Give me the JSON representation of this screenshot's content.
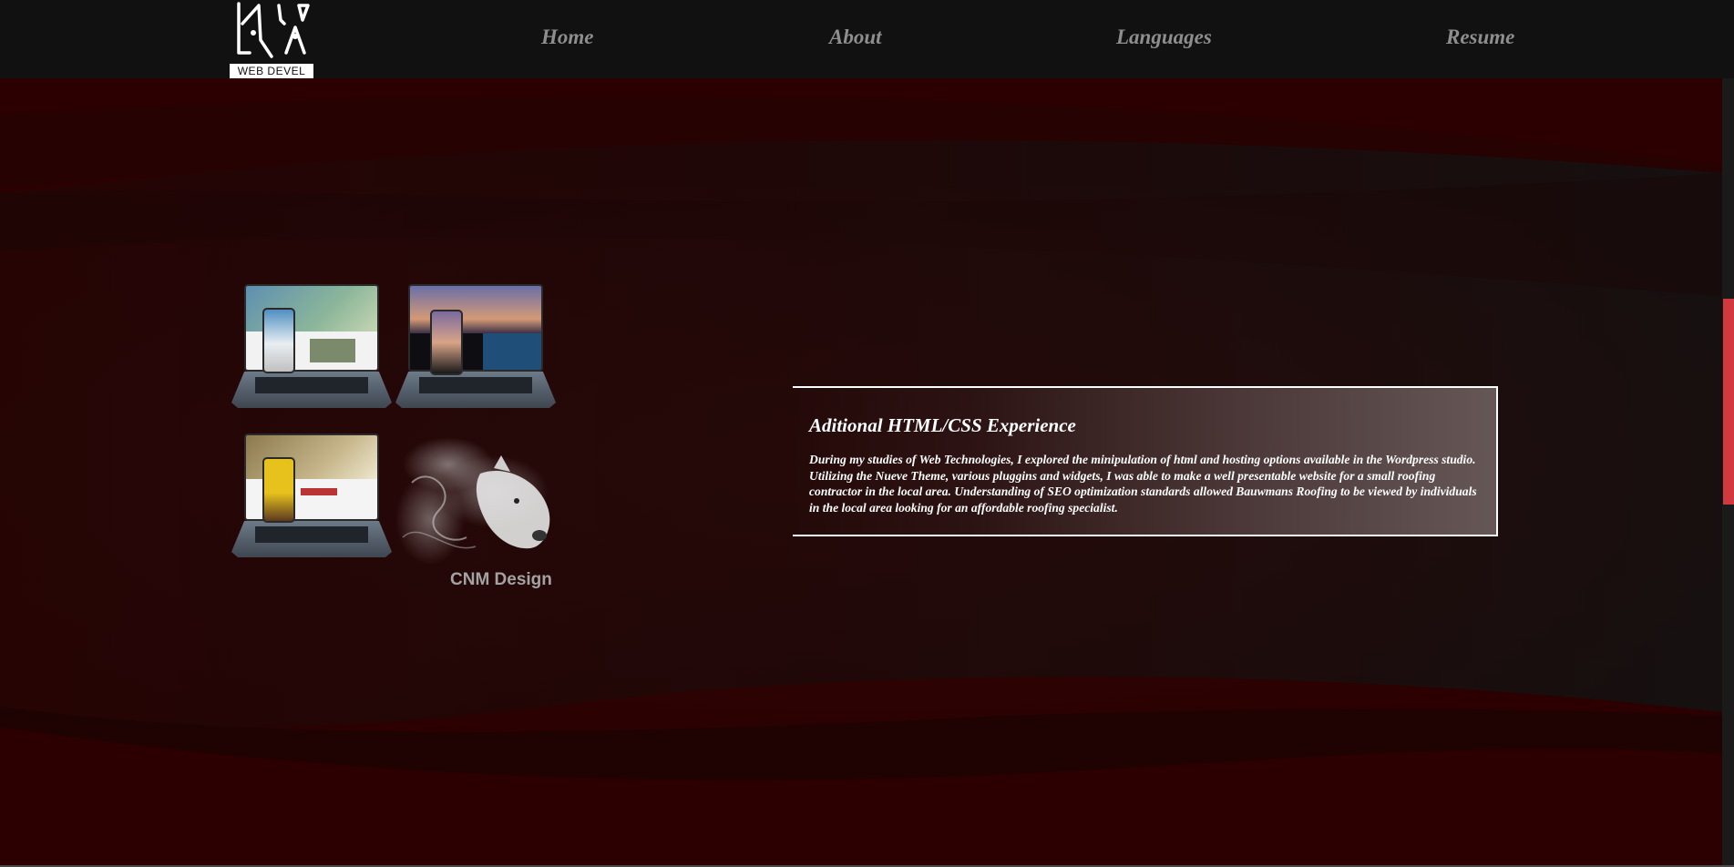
{
  "logo": {
    "text": "WEB DEVEL"
  },
  "nav": {
    "links": [
      {
        "label": "Home"
      },
      {
        "label": "About"
      },
      {
        "label": "Languages"
      },
      {
        "label": "Resume"
      }
    ]
  },
  "mockup": {
    "caption": "CNM Design"
  },
  "card": {
    "title": "Aditional HTML/CSS Experience",
    "body": "During my studies of Web Technologies, I explored the minipulation of html and hosting options available in the Wordpress studio. Utilizing the Nueve Theme, various pluggins and widgets, I was able to make a well presentable website for a small roofing contractor in the local area. Understanding of SEO optimization standards allowed Bauwmans Roofing to be viewed by individuals in the local area looking for an affordable roofing specialist."
  },
  "colors": {
    "navbar": "#111111",
    "hero_red": "#2c0000",
    "accent": "#d1393e",
    "nav_text": "#8e8e8e"
  }
}
